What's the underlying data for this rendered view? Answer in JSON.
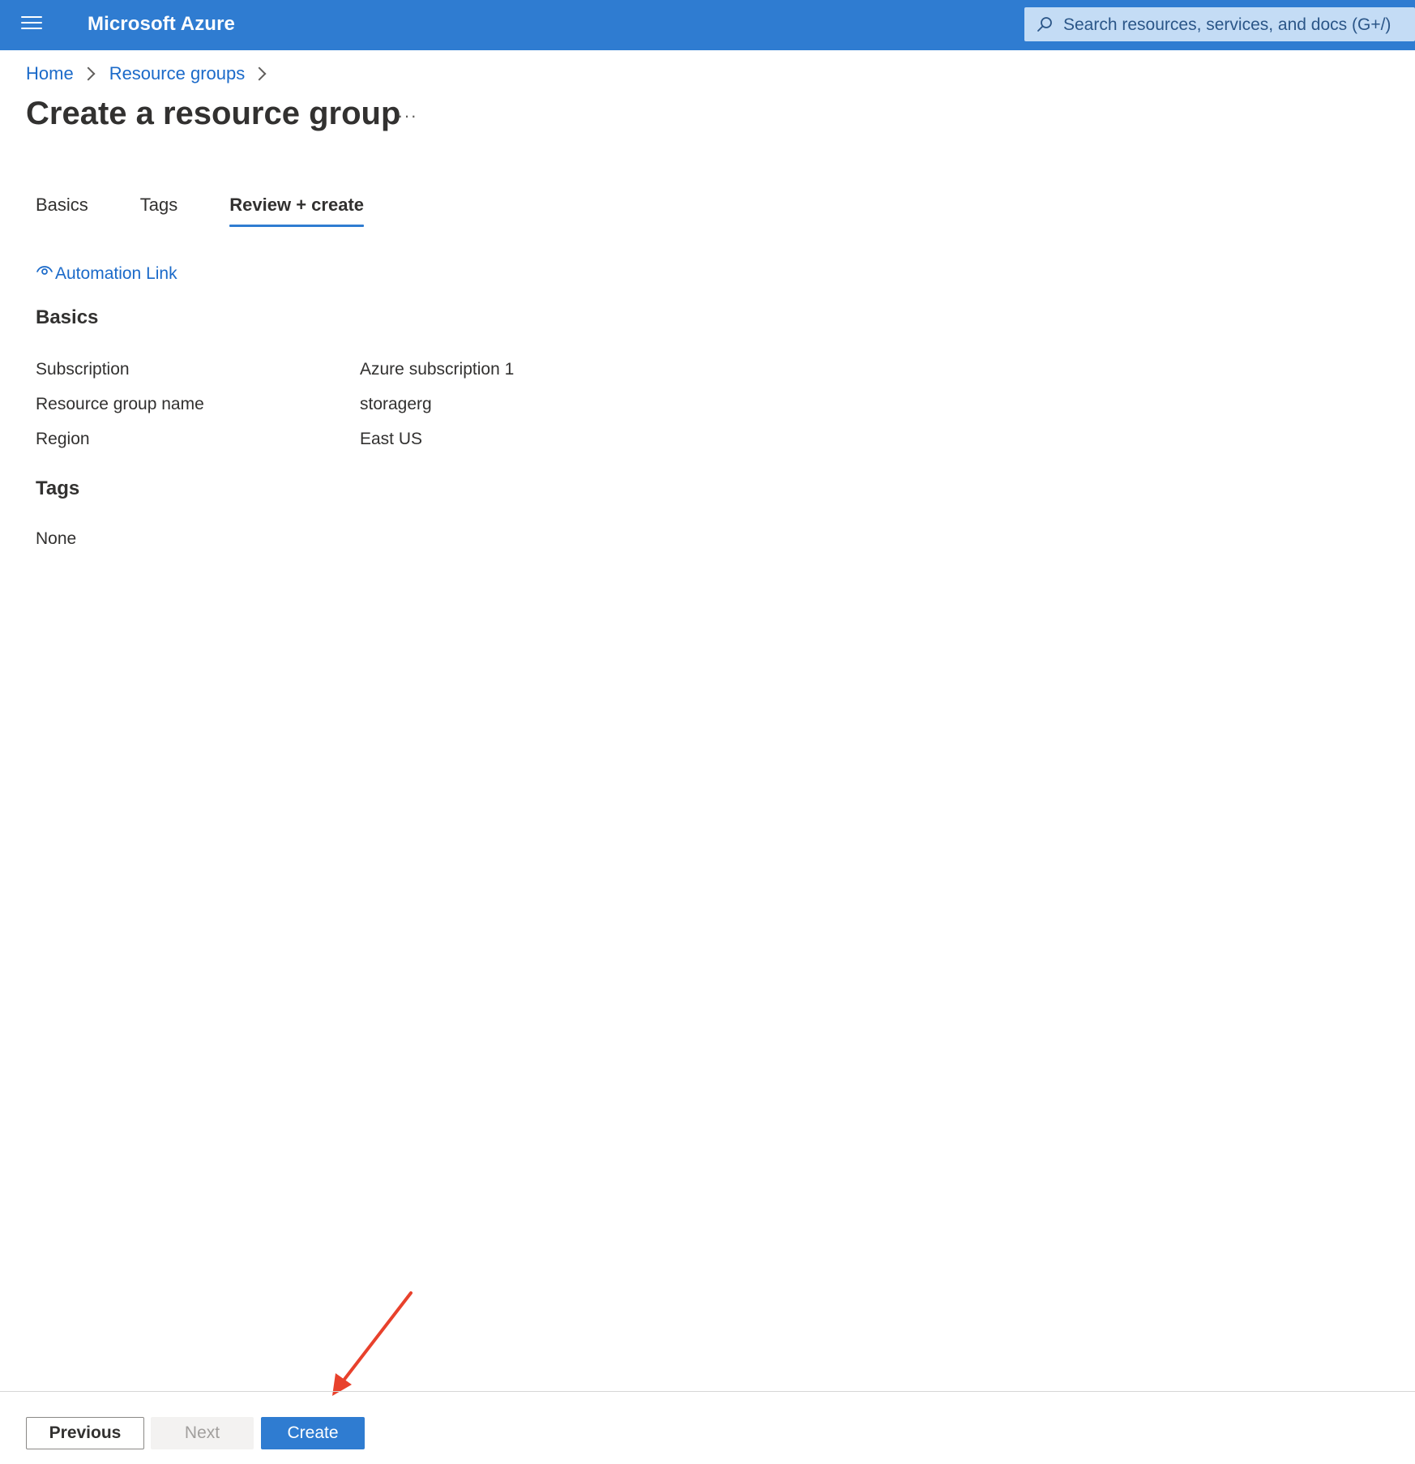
{
  "topbar": {
    "brand": "Microsoft Azure",
    "search_placeholder": "Search resources, services, and docs (G+/)",
    "color": "#2f7cd1"
  },
  "breadcrumb": {
    "items": [
      {
        "label": "Home"
      },
      {
        "label": "Resource groups"
      }
    ]
  },
  "page": {
    "title": "Create a resource group",
    "more": "···"
  },
  "tabs": [
    {
      "label": "Basics",
      "active": false
    },
    {
      "label": "Tags",
      "active": false
    },
    {
      "label": "Review + create",
      "active": true
    }
  ],
  "automation_link": {
    "label": "Automation Link",
    "icon": "eye-icon"
  },
  "review": {
    "basics": {
      "heading": "Basics",
      "fields": [
        {
          "label": "Subscription",
          "value": "Azure subscription 1"
        },
        {
          "label": "Resource group name",
          "value": "storagerg"
        },
        {
          "label": "Region",
          "value": "East US"
        }
      ]
    },
    "tags": {
      "heading": "Tags",
      "value": "None"
    }
  },
  "footer": {
    "previous_label": "Previous",
    "next_label": "Next",
    "create_label": "Create"
  },
  "colors": {
    "accent": "#2f7cd1",
    "link": "#1b6ac9",
    "annotation": "#e8412c"
  }
}
